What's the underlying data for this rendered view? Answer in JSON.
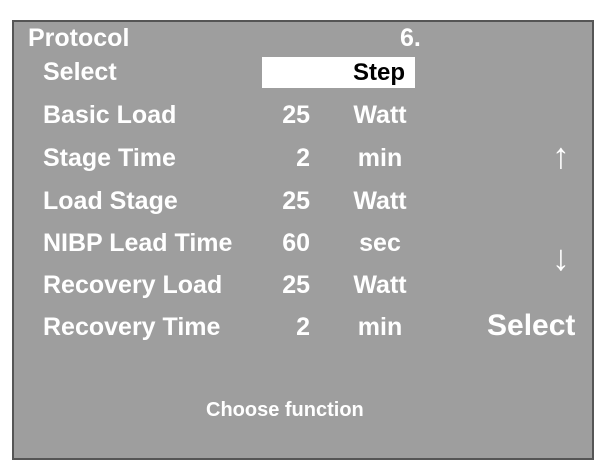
{
  "header": {
    "title": "Protocol",
    "page_number": "6."
  },
  "select_row": {
    "label": "Select",
    "value": "Step"
  },
  "rows": [
    {
      "label": "Basic Load",
      "value": "25",
      "unit": "Watt"
    },
    {
      "label": "Stage Time",
      "value": "2",
      "unit": "min"
    },
    {
      "label": "Load Stage",
      "value": "25",
      "unit": "Watt"
    },
    {
      "label": "NIBP Lead Time",
      "value": "60",
      "unit": "sec"
    },
    {
      "label": "Recovery Load",
      "value": "25",
      "unit": "Watt"
    },
    {
      "label": "Recovery Time",
      "value": "2",
      "unit": "min"
    }
  ],
  "softkeys": {
    "up": "↑",
    "down": "↓",
    "select": "Select"
  },
  "footer": {
    "text": "Choose function"
  },
  "colors": {
    "screen_bg": "#9e9e9e",
    "text": "#ffffff",
    "highlight_bg": "#ffffff",
    "highlight_text": "#000000"
  }
}
